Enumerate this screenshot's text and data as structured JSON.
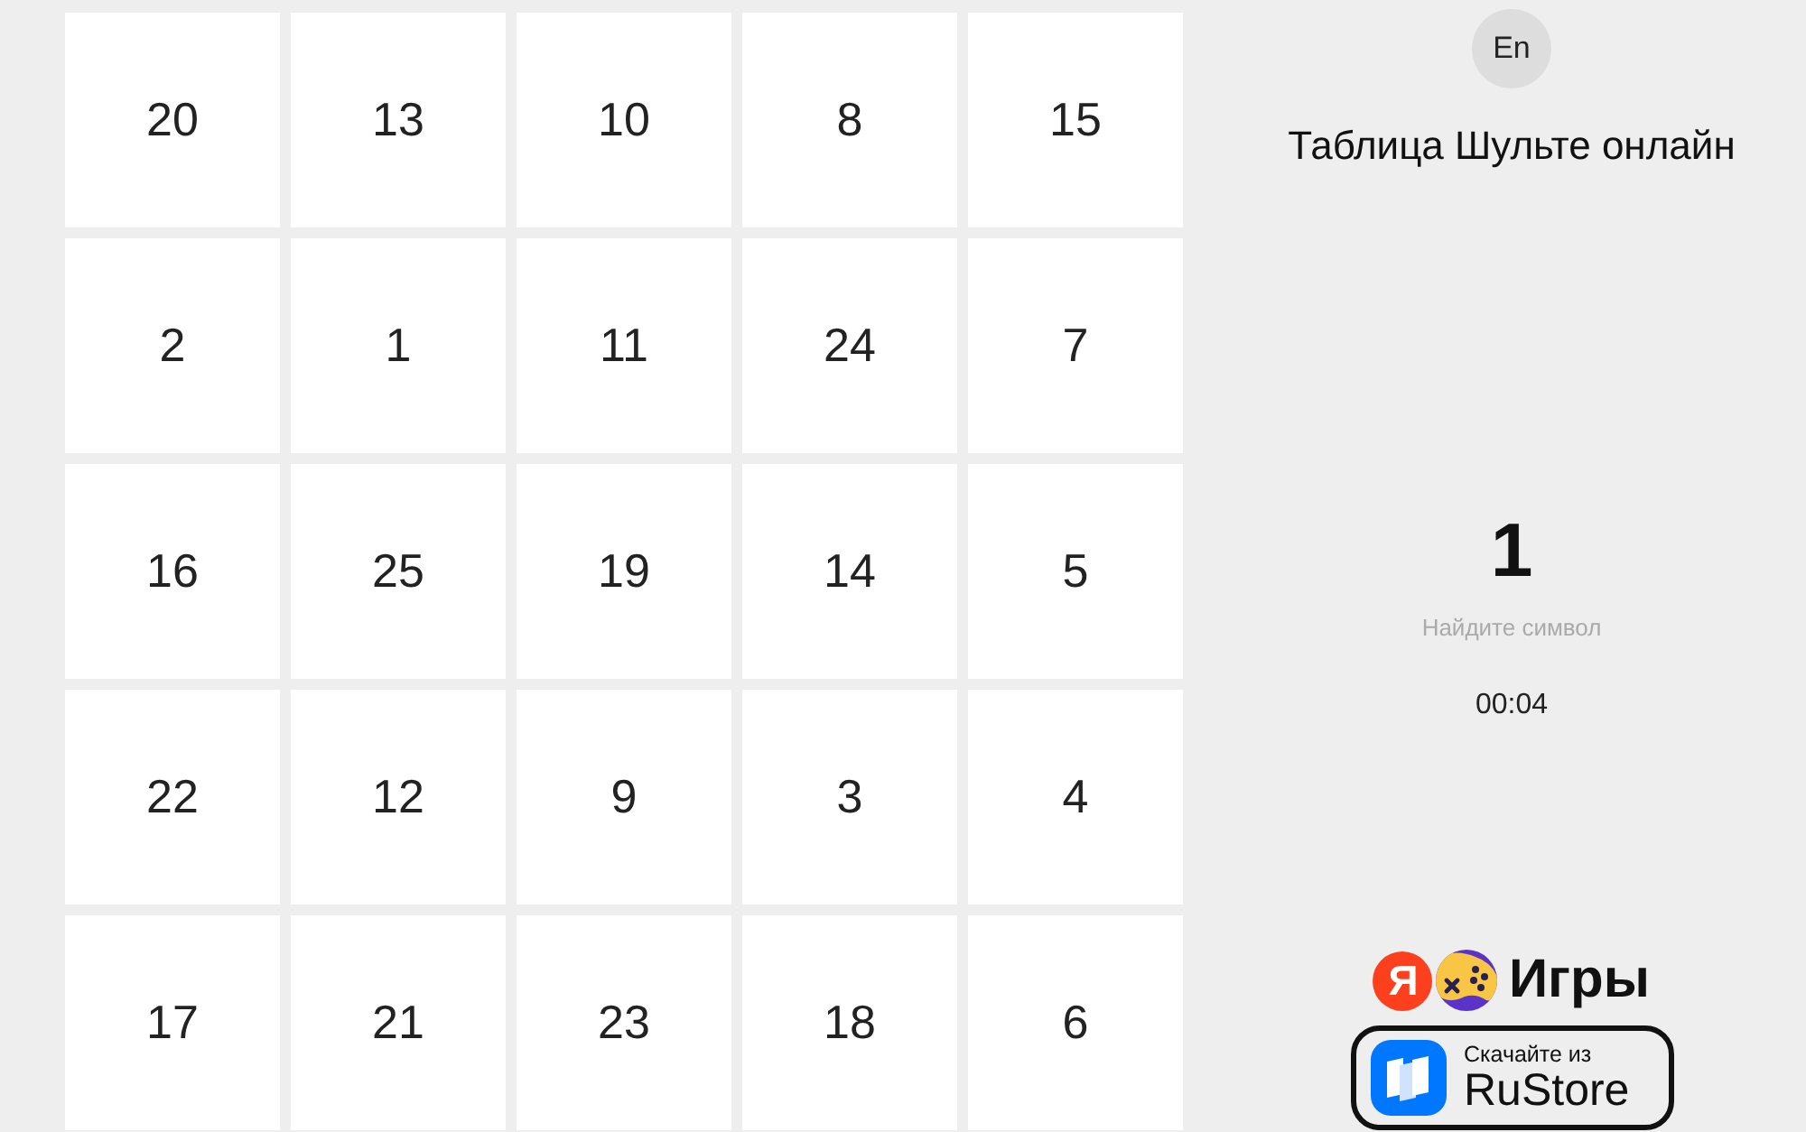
{
  "grid": {
    "rows": [
      [
        "20",
        "13",
        "10",
        "8",
        "15"
      ],
      [
        "2",
        "1",
        "11",
        "24",
        "7"
      ],
      [
        "16",
        "25",
        "19",
        "14",
        "5"
      ],
      [
        "22",
        "12",
        "9",
        "3",
        "4"
      ],
      [
        "17",
        "21",
        "23",
        "18",
        "6"
      ]
    ]
  },
  "language_button": {
    "label": "En"
  },
  "title": "Таблица Шульте онлайн",
  "target": {
    "symbol": "1",
    "hint": "Найдите символ"
  },
  "timer": "00:04",
  "games_logo": {
    "letter": "Я",
    "label": "Игры"
  },
  "store_badge": {
    "caption": "Скачайте из",
    "name": "RuStore"
  }
}
